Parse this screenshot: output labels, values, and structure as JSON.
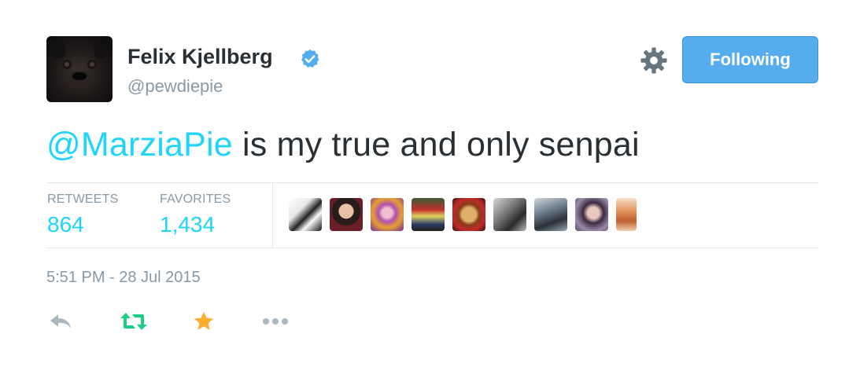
{
  "user": {
    "name": "Felix Kjellberg",
    "handle": "@pewdiepie",
    "verified": true
  },
  "header": {
    "follow_label": "Following",
    "gear_icon": "gear-icon"
  },
  "tweet": {
    "mention": "@MarziaPie",
    "text": " is my true and only senpai"
  },
  "stats": {
    "retweets_label": "RETWEETS",
    "retweets_value": "864",
    "favorites_label": "FAVORITES",
    "favorites_value": "1,434"
  },
  "facepile_icons": [
    "avatar-1",
    "avatar-2",
    "avatar-3",
    "avatar-4",
    "avatar-5",
    "avatar-6",
    "avatar-7",
    "avatar-8",
    "avatar-9"
  ],
  "timestamp": "5:51 PM - 28 Jul 2015",
  "actions": {
    "reply_icon": "reply-icon",
    "retweet_icon": "retweet-icon",
    "favorite_icon": "star-icon",
    "more_icon": "more-icon"
  },
  "colors": {
    "accent": "#55acee",
    "link": "#1ed4fa",
    "muted": "#8899a6",
    "text": "#292f33",
    "retweet_active": "#19cf86",
    "favorite_active": "#ffac33"
  }
}
